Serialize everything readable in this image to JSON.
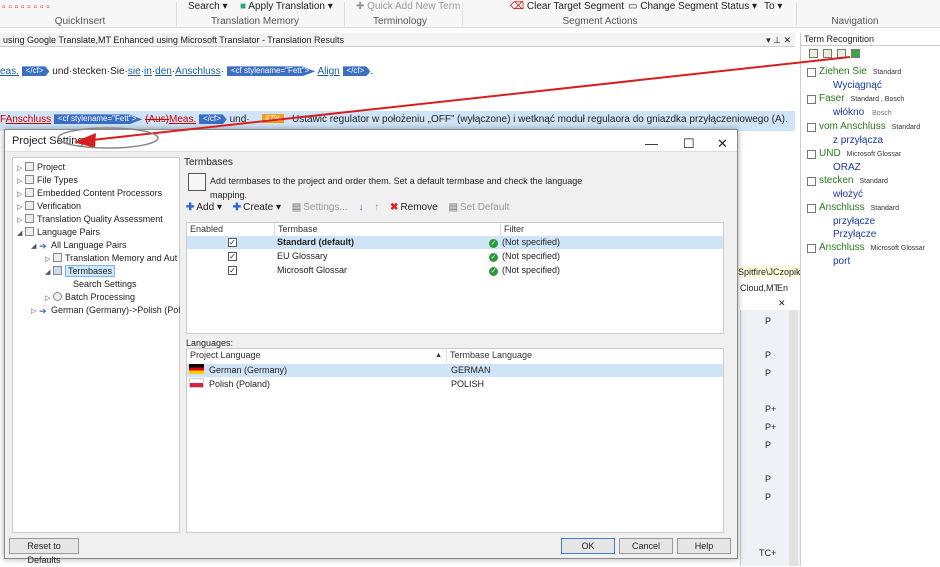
{
  "ribbon": {
    "buttons": [
      {
        "label": "Search",
        "caret": "▾"
      },
      {
        "label": "Apply Translation",
        "caret": "▾"
      },
      {
        "label": "Quick Add New Term"
      },
      {
        "label": "Clear Target Segment"
      },
      {
        "label": "Change Segment Status",
        "caret": "▾"
      },
      {
        "label": "To",
        "caret": "▾"
      }
    ],
    "groups": [
      "QuickInsert",
      "Translation Memory",
      "Terminology",
      "Segment Actions",
      "Navigation"
    ]
  },
  "results_panel": {
    "title": "using Google Translate,MT Enhanced using Microsoft Translator - Translation Results"
  },
  "editor": {
    "line1": {
      "pre": "eas.",
      "tag1": "</cf>",
      "mid": "und·stecken·Sie·",
      "w_sie": "sie",
      "w_in": "in",
      "w_den": "den",
      "w_anschluss": "Anschluss",
      "tag2": "<cf stylename=\"Fett\">",
      "w_align": "Align",
      "tag3": "</cf>",
      "end": "."
    },
    "row2": {
      "src_pre": "F",
      "src_word": "Anschluss",
      "tag_a": "<cf stylename=\"Fett\">",
      "strike": "(Aus)",
      "meas": "Meas.",
      "tag_b": "</cf>",
      "und": "und·",
      "badge": "47%",
      "target": "Ustawić regulator w położeniu „OFF” (wyłączone) i wetknąć moduł regulaora do gniazdka przyłączeniowego (A)."
    }
  },
  "term_recognition": {
    "title": "Term Recognition",
    "entries": [
      {
        "source": "Ziehen Sie",
        "tb": "Standard",
        "targets": [
          {
            "t": "Wyciągnąć"
          }
        ]
      },
      {
        "source": "Faser",
        "tb": "Standard , Bosch",
        "targets": [
          {
            "t": "włókno",
            "tb": "Bosch"
          }
        ]
      },
      {
        "source": "vom Anschluss",
        "tb": "Standard",
        "targets": [
          {
            "t": "z przyłącza"
          }
        ]
      },
      {
        "source": "UND",
        "tb": "Microsoft Glossar",
        "targets": [
          {
            "t": "ORAZ"
          }
        ]
      },
      {
        "source": "stecken",
        "tb": "Standard",
        "targets": [
          {
            "t": "włożyć"
          }
        ]
      },
      {
        "source": "Anschluss",
        "tb": "Standard",
        "targets": [
          {
            "t": "przyłącze"
          },
          {
            "t": "Przyłącze"
          }
        ]
      },
      {
        "source": "Anschluss",
        "tb": "Microsoft Glossar",
        "targets": [
          {
            "t": "port"
          }
        ]
      }
    ]
  },
  "bg_fragments": {
    "spitfire": "Spitfire\\JCzopik",
    "cloud": "Cloud,MT",
    "en": "En",
    "status_values": [
      "P",
      "P",
      "P",
      "P+",
      "P+",
      "P",
      "P",
      "P",
      "TC+"
    ]
  },
  "dialog": {
    "title": "Project Settings",
    "tree": [
      {
        "label": "Project",
        "level": 0,
        "arrow": "▷"
      },
      {
        "label": "File Types",
        "level": 0,
        "arrow": "▷"
      },
      {
        "label": "Embedded Content Processors",
        "level": 0,
        "arrow": "▷"
      },
      {
        "label": "Verification",
        "level": 0,
        "arrow": "▷"
      },
      {
        "label": "Translation Quality Assessment",
        "level": 0,
        "arrow": "▷"
      },
      {
        "label": "Language Pairs",
        "level": 0,
        "arrow": "◢"
      },
      {
        "label": "All Language Pairs",
        "level": 1,
        "arrow": "◢"
      },
      {
        "label": "Translation Memory and Aut",
        "level": 2,
        "arrow": "▷"
      },
      {
        "label": "Termbases",
        "level": 2,
        "arrow": "◢",
        "selected": true
      },
      {
        "label": "Search Settings",
        "level": 3,
        "arrow": ""
      },
      {
        "label": "Batch Processing",
        "level": 2,
        "arrow": "▷"
      },
      {
        "label": "German (Germany)->Polish (Pol",
        "level": 1,
        "arrow": "▷"
      }
    ],
    "section_title": "Termbases",
    "info": "Add termbases to the project and order them. Set a default termbase and check the language mapping.",
    "toolbar": {
      "add": "Add",
      "create": "Create",
      "settings": "Settings...",
      "remove": "Remove",
      "set_default": "Set Default"
    },
    "grid": {
      "headers": [
        "Enabled",
        "Termbase",
        "Filter"
      ],
      "rows": [
        {
          "enabled": true,
          "name": "Standard (default)",
          "filter": "(Not specified)",
          "selected": true,
          "bold": true
        },
        {
          "enabled": true,
          "name": "EU Glossary",
          "filter": "(Not specified)"
        },
        {
          "enabled": true,
          "name": "Microsoft Glossar",
          "filter": "(Not specified)"
        }
      ]
    },
    "languages": {
      "label": "Languages:",
      "headers": [
        "Project Language",
        "Termbase Language"
      ],
      "rows": [
        {
          "project": "German (Germany)",
          "termbase": "GERMAN",
          "flag": "de",
          "selected": true
        },
        {
          "project": "Polish (Poland)",
          "termbase": "POLISH",
          "flag": "pl"
        }
      ]
    },
    "buttons": {
      "reset": "Reset to Defaults",
      "ok": "OK",
      "cancel": "Cancel",
      "help": "Help"
    }
  },
  "colors": {
    "annotation_red": "#d62020",
    "selection": "#cfe4f7",
    "term_source": "#2d7a1e",
    "term_target": "#1a3a9c"
  }
}
